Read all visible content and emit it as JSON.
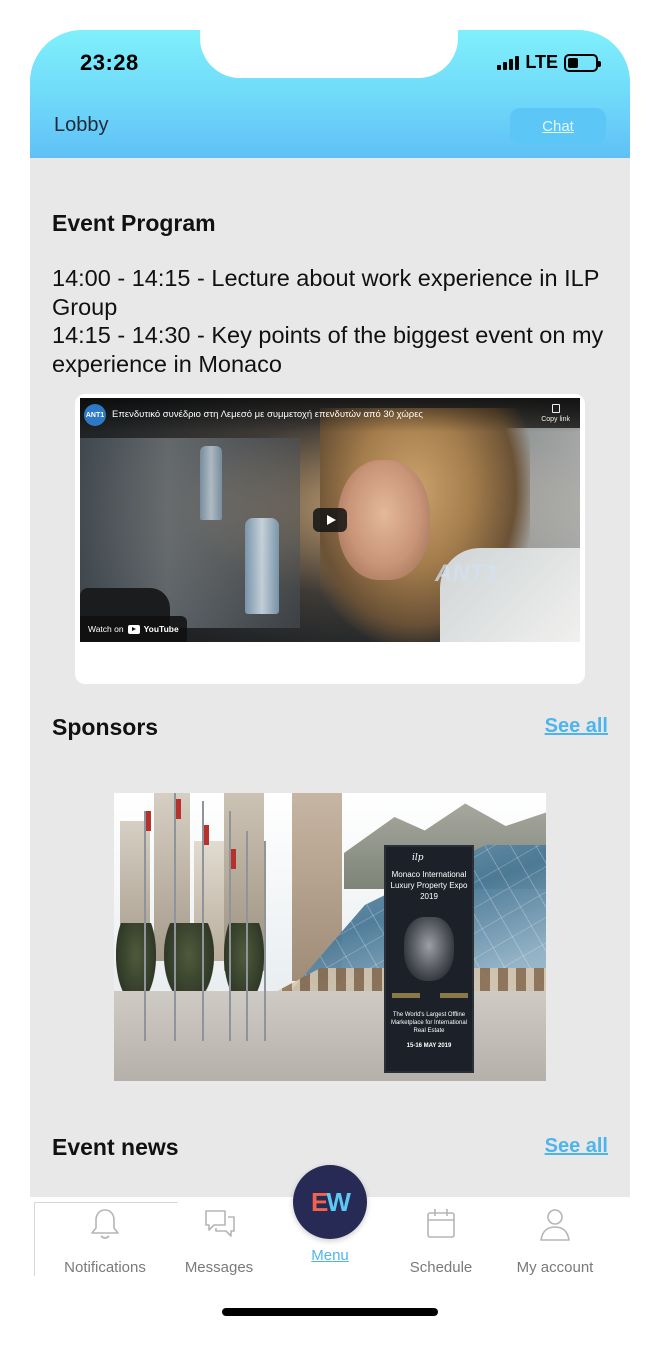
{
  "status_bar": {
    "time": "23:28",
    "network": "LTE"
  },
  "header": {
    "title": "Lobby",
    "chat_label": "Chat"
  },
  "event_program": {
    "title": "Event Program",
    "lines": [
      "14:00 - 14:15 - Lecture about work experience in ILP Group",
      "14:15 - 14:30 - Key points of the biggest event on my experience in Monaco"
    ],
    "video": {
      "channel": "ANT1",
      "title": "Επενδυτικό συνέδριο στη Λεμεσό με συμμετοχή επενδυτών από 30 χώρες",
      "copy_link": "Copy link",
      "watch_on": "Watch on",
      "youtube": "YouTube",
      "watermark": "ANT1"
    }
  },
  "sponsors": {
    "title": "Sponsors",
    "see_all": "See all",
    "banner": {
      "logo": "ilp",
      "title": "Monaco International Luxury Property Expo 2019",
      "tagline": "The World's Largest Offline Marketplace for International Real Estate",
      "dates": "15-16 MAY 2019"
    }
  },
  "event_news": {
    "title": "Event news",
    "see_all": "See all"
  },
  "tabbar": {
    "items": [
      {
        "label": "Notifications",
        "icon": "bell-icon"
      },
      {
        "label": "Messages",
        "icon": "messages-icon"
      },
      {
        "label": "Menu",
        "icon": "ew-logo"
      },
      {
        "label": "Schedule",
        "icon": "calendar-icon"
      },
      {
        "label": "My account",
        "icon": "user-icon"
      }
    ],
    "menu_logo_e": "E",
    "menu_logo_w": "W"
  },
  "colors": {
    "header_top": "#7ff0fb",
    "header_bottom": "#5fc0f6",
    "accent_link": "#4db5ec",
    "fab_bg": "#262a55",
    "fab_e": "#f3634b",
    "fab_w": "#5ec8f5",
    "content_bg": "#e8e8e8"
  }
}
